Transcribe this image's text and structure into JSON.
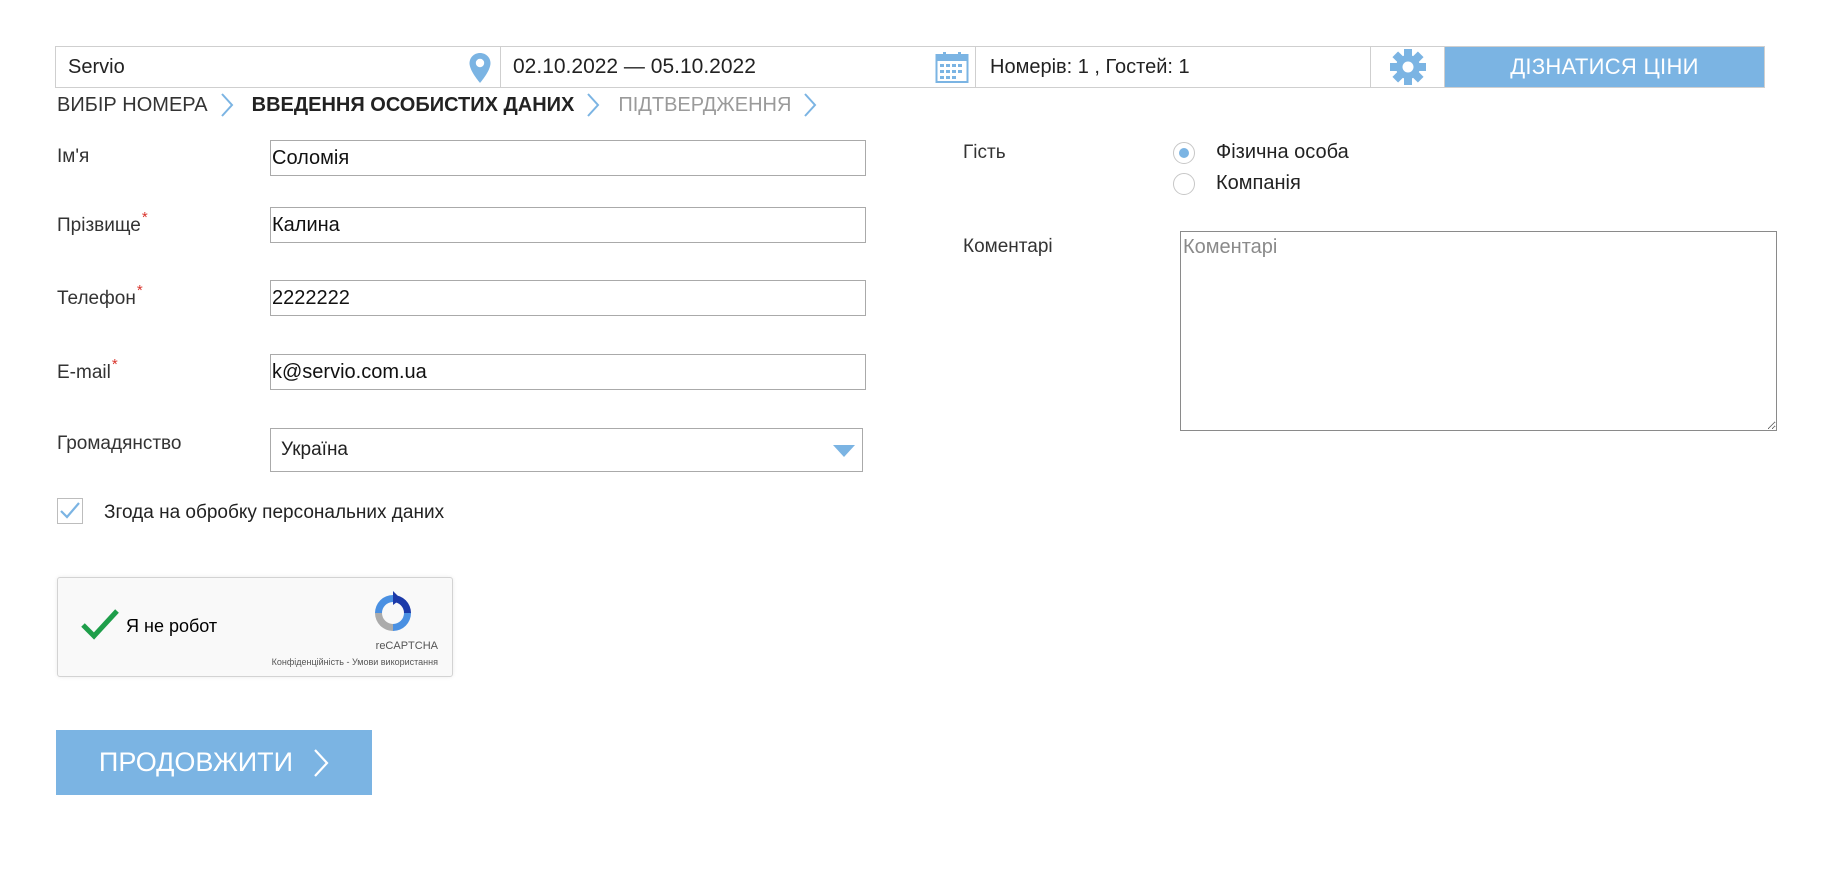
{
  "search": {
    "hotel": "Servio",
    "dates": "02.10.2022 — 05.10.2022",
    "guests": "Номерів: 1 , Гостей: 1",
    "button": "ДІЗНАТИСЯ ЦІНИ"
  },
  "steps": [
    {
      "label": "ВИБІР НОМЕРА",
      "state": "done"
    },
    {
      "label": "ВВЕДЕННЯ ОСОБИСТИХ ДАНИХ",
      "state": "active"
    },
    {
      "label": "ПІДТВЕРДЖЕННЯ",
      "state": "future"
    }
  ],
  "form": {
    "first_name": {
      "label": "Ім'я",
      "value": "Соломія"
    },
    "last_name": {
      "label": "Прізвище",
      "value": "Калина",
      "required_mark": "*"
    },
    "phone": {
      "label": "Телефон",
      "value": "2222222",
      "required_mark": "*"
    },
    "email": {
      "label": "E-mail",
      "value": "k@servio.com.ua",
      "required_mark": "*"
    },
    "citizenship": {
      "label": "Громадянство",
      "value": "Україна"
    },
    "consent": {
      "label": "Згода на обробку персональних даних",
      "checked": true
    }
  },
  "guest": {
    "label": "Гість",
    "options": [
      {
        "label": "Фізична особа",
        "selected": true
      },
      {
        "label": "Компанія",
        "selected": false
      }
    ]
  },
  "comments": {
    "label": "Коментарі",
    "placeholder": "Коментарі"
  },
  "captcha": {
    "label": "Я не робот",
    "brand": "reCAPTCHA",
    "links": "Конфіденційність - Умови використання"
  },
  "continue_label": "ПРОДОВЖИТИ",
  "colors": {
    "accent": "#7bb4e3",
    "required": "#d9342b",
    "check": "#1e9e4a"
  }
}
